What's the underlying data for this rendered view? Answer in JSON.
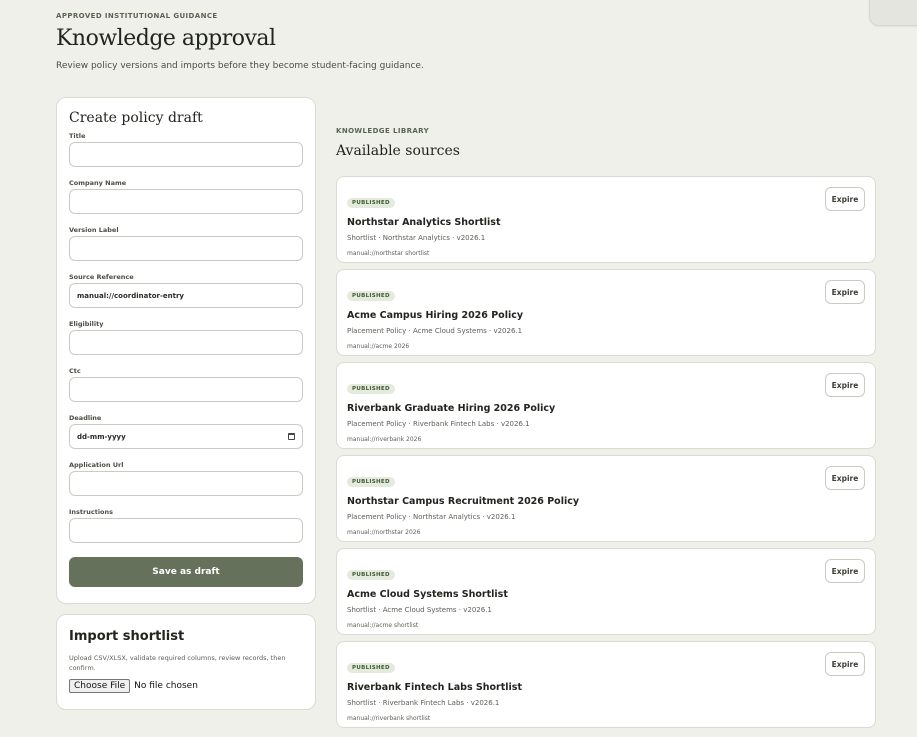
{
  "header": {
    "eyebrow": "APPROVED INSTITUTIONAL GUIDANCE",
    "title": "Knowledge approval",
    "subtitle": "Review policy versions and imports before they become student-facing guidance."
  },
  "form": {
    "title": "Create policy draft",
    "fields": [
      {
        "label": "Title",
        "value": ""
      },
      {
        "label": "Company Name",
        "value": ""
      },
      {
        "label": "Version Label",
        "value": ""
      },
      {
        "label": "Source Reference",
        "value": "manual://coordinator-entry"
      },
      {
        "label": "Eligibility",
        "value": ""
      },
      {
        "label": "Ctc",
        "value": ""
      },
      {
        "label": "Deadline",
        "value": "dd-mm-yyyy"
      },
      {
        "label": "Application Url",
        "value": ""
      },
      {
        "label": "Instructions",
        "value": ""
      }
    ],
    "save_label": "Save as draft"
  },
  "import": {
    "title": "Import shortlist",
    "description": "Upload CSV/XLSX, validate required columns, review records, then confirm.",
    "file_button": "Choose File",
    "file_status": "No file chosen"
  },
  "library": {
    "eyebrow": "KNOWLEDGE LIBRARY",
    "title": "Available sources",
    "expire_label": "Expire",
    "sources": [
      {
        "status": "PUBLISHED",
        "title": "Northstar Analytics Shortlist",
        "meta": "Shortlist · Northstar Analytics · v2026.1",
        "ref": "manual://northstar shortlist"
      },
      {
        "status": "PUBLISHED",
        "title": "Acme Campus Hiring 2026 Policy",
        "meta": "Placement Policy · Acme Cloud Systems · v2026.1",
        "ref": "manual://acme 2026"
      },
      {
        "status": "PUBLISHED",
        "title": "Riverbank Graduate Hiring 2026 Policy",
        "meta": "Placement Policy · Riverbank Fintech Labs · v2026.1",
        "ref": "manual://riverbank 2026"
      },
      {
        "status": "PUBLISHED",
        "title": "Northstar Campus Recruitment 2026 Policy",
        "meta": "Placement Policy · Northstar Analytics · v2026.1",
        "ref": "manual://northstar 2026"
      },
      {
        "status": "PUBLISHED",
        "title": "Acme Cloud Systems Shortlist",
        "meta": "Shortlist · Acme Cloud Systems · v2026.1",
        "ref": "manual://acme shortlist"
      },
      {
        "status": "PUBLISHED",
        "title": "Riverbank Fintech Labs Shortlist",
        "meta": "Shortlist · Riverbank Fintech Labs · v2026.1",
        "ref": "manual://riverbank shortlist"
      }
    ]
  }
}
